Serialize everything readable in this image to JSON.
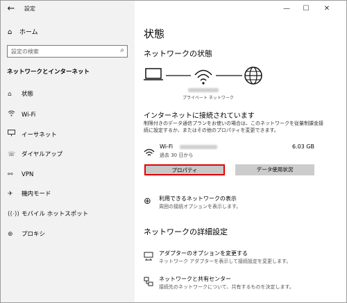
{
  "window": {
    "title": "設定"
  },
  "sidebar": {
    "home_label": "ホーム",
    "search_placeholder": "設定の検索",
    "section_title": "ネットワークとインターネット",
    "items": [
      {
        "label": "状態",
        "icon": "home-globe-icon"
      },
      {
        "label": "Wi-Fi",
        "icon": "wifi-icon"
      },
      {
        "label": "イーサネット",
        "icon": "ethernet-icon"
      },
      {
        "label": "ダイヤルアップ",
        "icon": "dialup-icon"
      },
      {
        "label": "VPN",
        "icon": "vpn-icon"
      },
      {
        "label": "機内モード",
        "icon": "airplane-icon"
      },
      {
        "label": "モバイル ホットスポット",
        "icon": "hotspot-icon"
      },
      {
        "label": "プロキシ",
        "icon": "globe-icon"
      }
    ]
  },
  "main": {
    "title": "状態",
    "network_status_heading": "ネットワークの状態",
    "diagram_label": "プライベート ネットワーク",
    "connected_heading": "インターネットに接続されています",
    "description": "制限付きのデータ通信プランをお使いの場合は、このネットワークを従量制課金接続に設定するか、またはその他のプロパティを変更できます。",
    "wifi": {
      "name_prefix": "Wi-Fi",
      "sub": "過去 30 日から",
      "usage": "6.03 GB"
    },
    "buttons": {
      "properties": "プロパティ",
      "data_usage": "データ使用状況"
    },
    "show_networks": {
      "title": "利用できるネットワークの表示",
      "sub": "周囲の接続オプションを表示します。"
    },
    "advanced_heading": "ネットワークの詳細設定",
    "adapter": {
      "title": "アダプターのオプションを変更する",
      "sub": "ネットワーク アダプターを表示して接続設定を変更します。"
    },
    "sharing": {
      "title": "ネットワークと共有センター",
      "sub": "接続先のネットワークについて、共有するものを決定します。"
    }
  }
}
